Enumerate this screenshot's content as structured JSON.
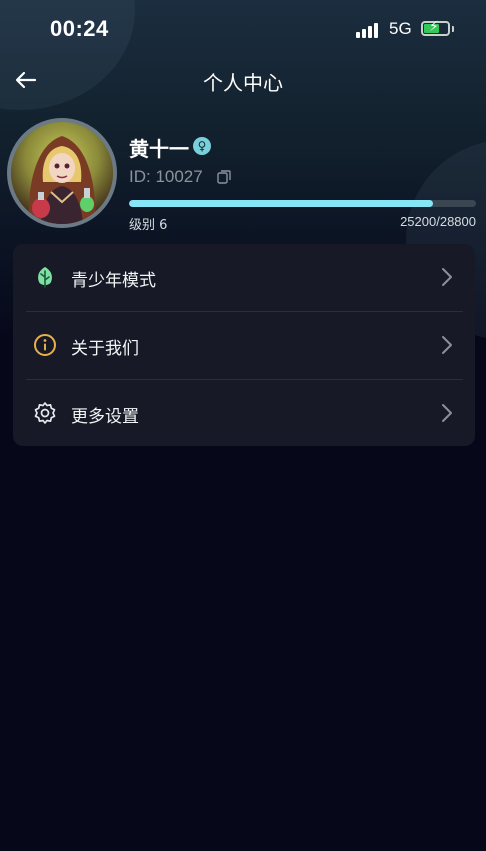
{
  "status_bar": {
    "time": "00:24",
    "network": "5G",
    "battery_level": 0.6
  },
  "nav": {
    "title": "个人中心"
  },
  "profile": {
    "name": "黄十一",
    "id_text": "ID: 10027",
    "level_text": "级别 6",
    "exp_text": "25200/28800",
    "progress": 0.875
  },
  "menu": {
    "items": [
      {
        "label": "青少年模式",
        "icon": "leaf-icon"
      },
      {
        "label": "关于我们",
        "icon": "info-icon"
      },
      {
        "label": "更多设置",
        "icon": "gear-icon"
      }
    ]
  },
  "colors": {
    "background": "#06081a",
    "card": "#171a26",
    "progress": "#86e6f5",
    "leaf": "#7ee0a3",
    "info": "#e9b04a"
  }
}
